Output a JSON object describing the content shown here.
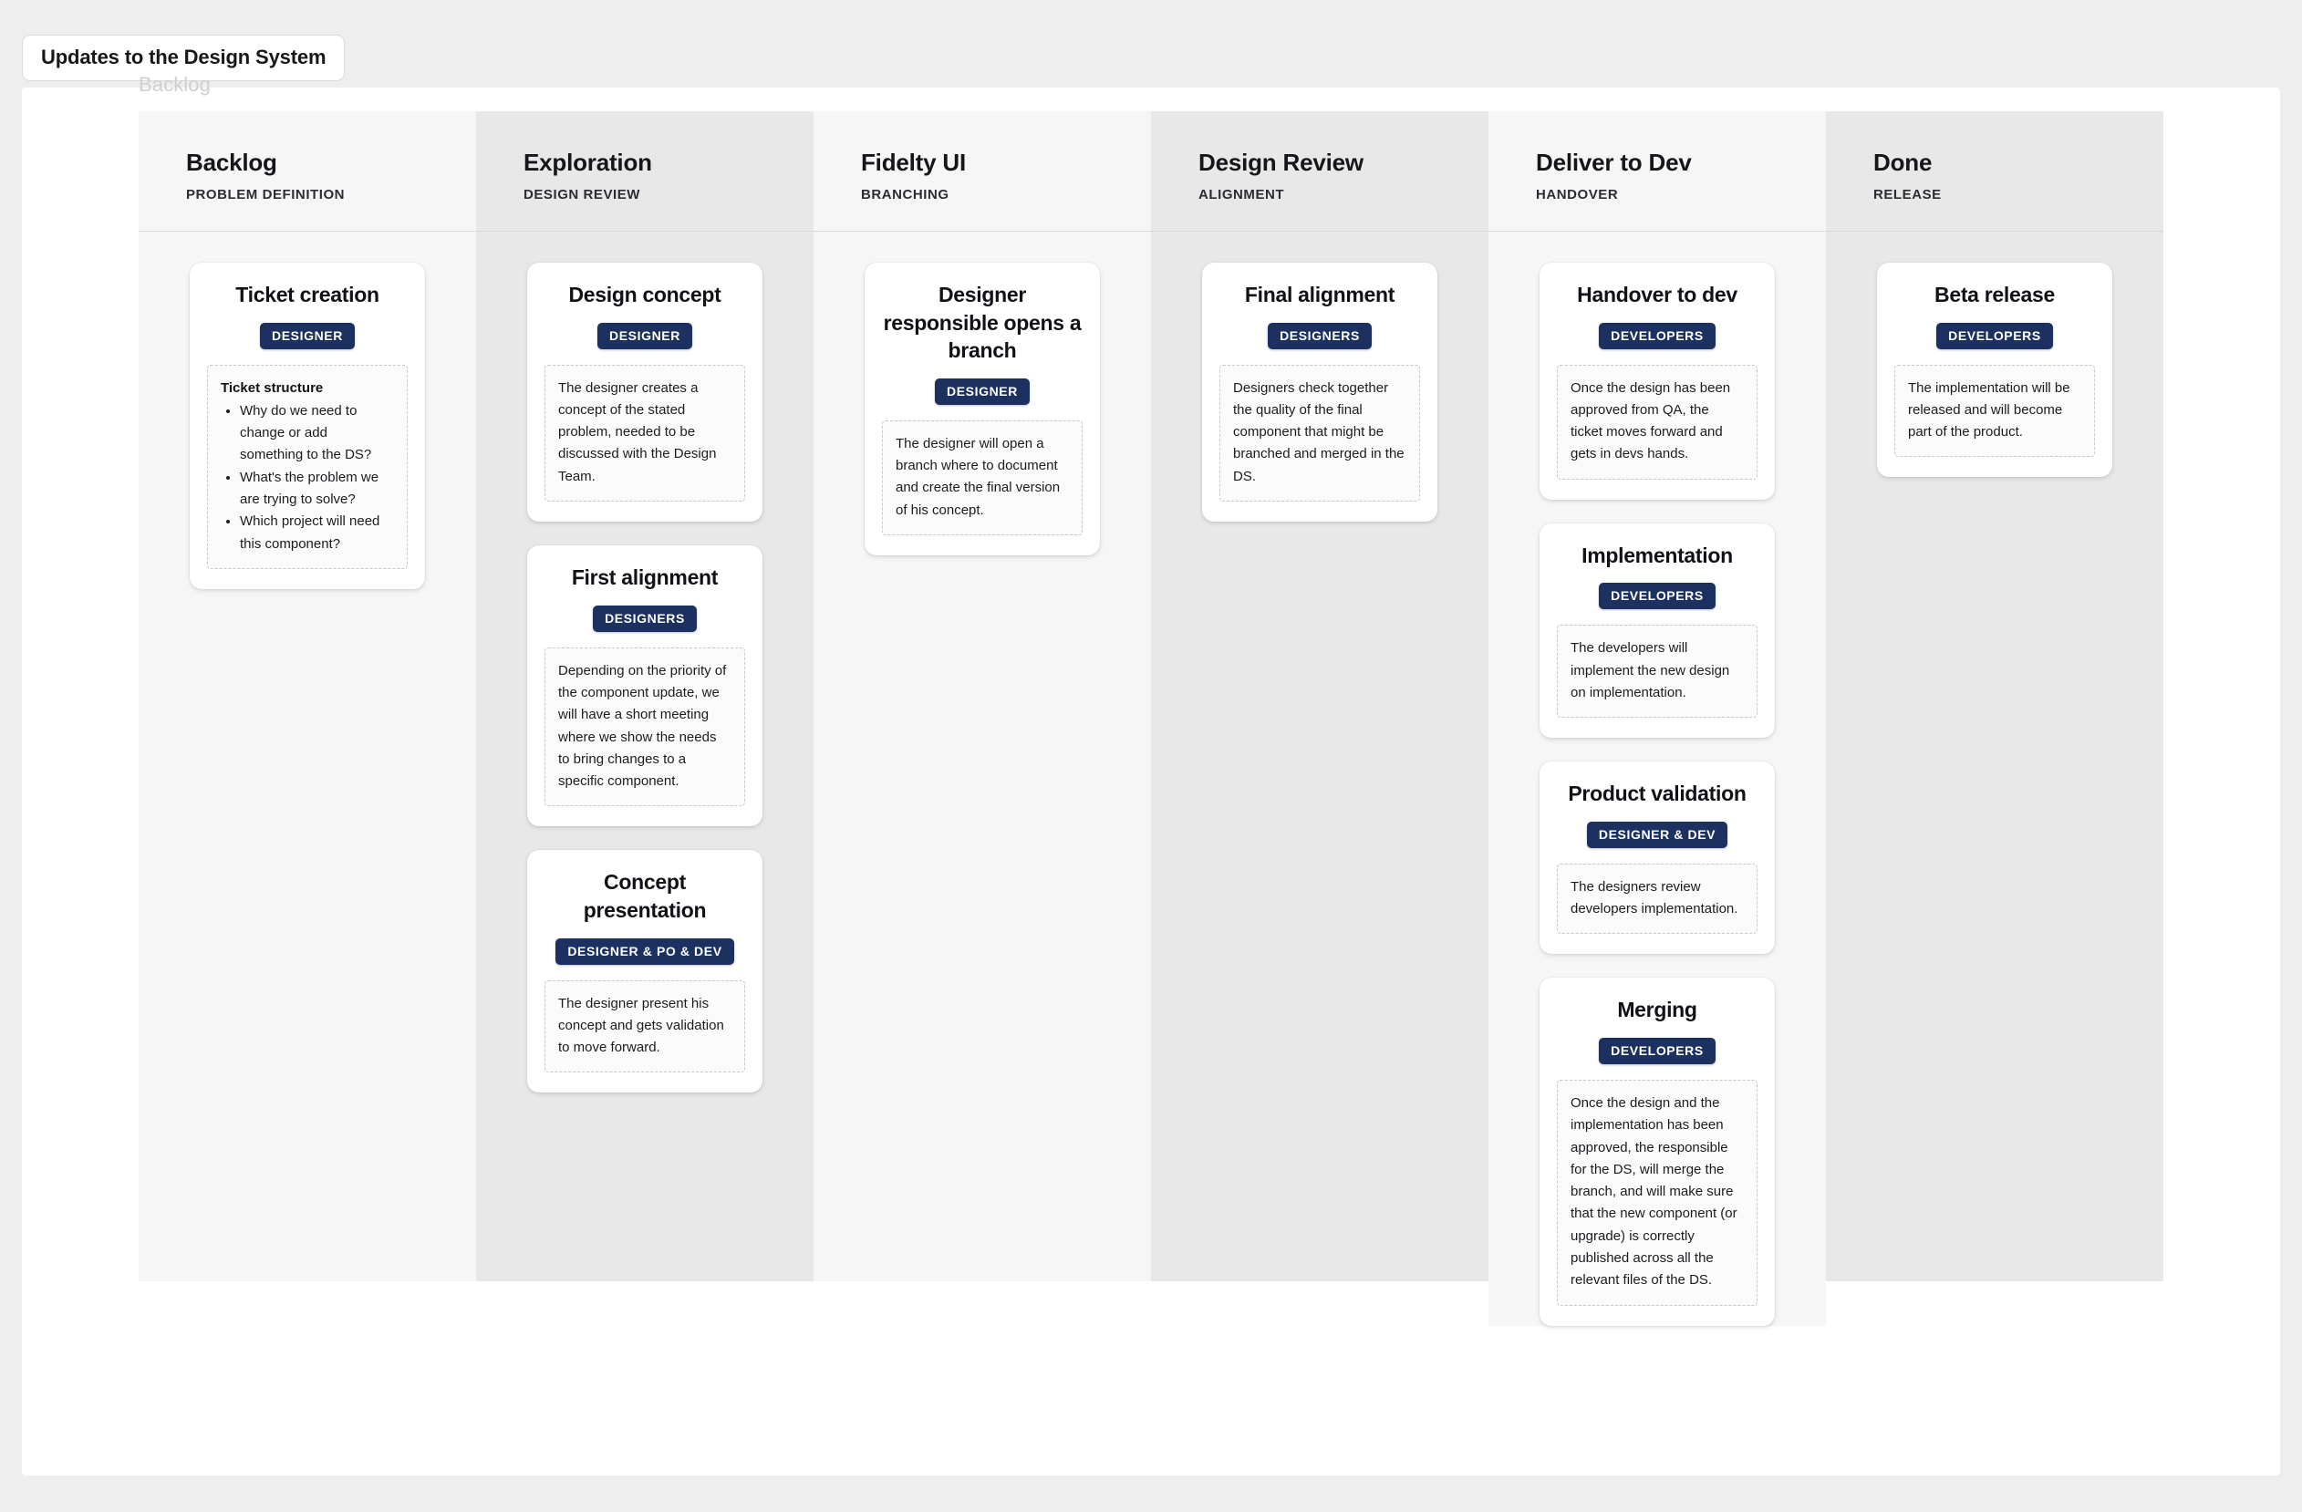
{
  "app": {
    "tab_title": "Updates to the Design System",
    "board_label": "Backlog"
  },
  "colors": {
    "badge_background": "#1c3160",
    "badge_text": "#ffffff",
    "column_shade_light": "#f6f6f6",
    "column_shade_dark": "#e8e8e8",
    "canvas": "#ffffff",
    "page_background": "#eeeeee"
  },
  "columns": [
    {
      "title": "Backlog",
      "subtitle": "PROBLEM DEFINITION",
      "shade": "light",
      "cards": [
        {
          "title": "Ticket creation",
          "badge": "DESIGNER",
          "note_heading": "Ticket structure",
          "note_list": [
            "Why do we need to change or add something to the DS?",
            "What's the problem we are trying to solve?",
            "Which project will need this component?"
          ]
        }
      ]
    },
    {
      "title": "Exploration",
      "subtitle": "DESIGN REVIEW",
      "shade": "dark",
      "cards": [
        {
          "title": "Design concept",
          "badge": "DESIGNER",
          "note": "The designer creates a concept of the stated problem, needed to be discussed with the Design Team."
        },
        {
          "title": "First alignment",
          "badge": "DESIGNERS",
          "note": "Depending on the priority of the component update, we will have a short meeting where we show the needs to bring changes to a specific component."
        },
        {
          "title": "Concept presentation",
          "badge": "DESIGNER & PO & DEV",
          "note": "The designer present his concept and gets validation to move forward."
        }
      ]
    },
    {
      "title": "Fidelty UI",
      "subtitle": "BRANCHING",
      "shade": "light",
      "cards": [
        {
          "title": "Designer responsible opens a branch",
          "badge": "DESIGNER",
          "note": "The designer will open a branch where to document and create the final version of his concept."
        }
      ]
    },
    {
      "title": "Design Review",
      "subtitle": "ALIGNMENT",
      "shade": "dark",
      "cards": [
        {
          "title": "Final alignment",
          "badge": "DESIGNERS",
          "note": "Designers check together the quality of the final component that might be branched and merged in the DS."
        }
      ]
    },
    {
      "title": "Deliver to Dev",
      "subtitle": "HANDOVER",
      "shade": "light",
      "cards": [
        {
          "title": "Handover to dev",
          "badge": "DEVELOPERS",
          "note": "Once the design has been approved from QA, the ticket moves forward and gets in devs hands."
        },
        {
          "title": "Implementation",
          "badge": "DEVELOPERS",
          "note": "The developers will implement the new design on implementation."
        },
        {
          "title": "Product validation",
          "badge": "DESIGNER & DEV",
          "note": "The designers review developers implementation."
        },
        {
          "title": "Merging",
          "badge": "DEVELOPERS",
          "note": "Once the design and the implementation has been approved, the responsible for the DS, will merge the branch, and will make sure that the new component (or upgrade) is correctly published across all the relevant files of the DS."
        }
      ]
    },
    {
      "title": "Done",
      "subtitle": "RELEASE",
      "shade": "dark",
      "cards": [
        {
          "title": "Beta release",
          "badge": "DEVELOPERS",
          "note": "The implementation will be released and will become part of the product."
        }
      ]
    }
  ]
}
